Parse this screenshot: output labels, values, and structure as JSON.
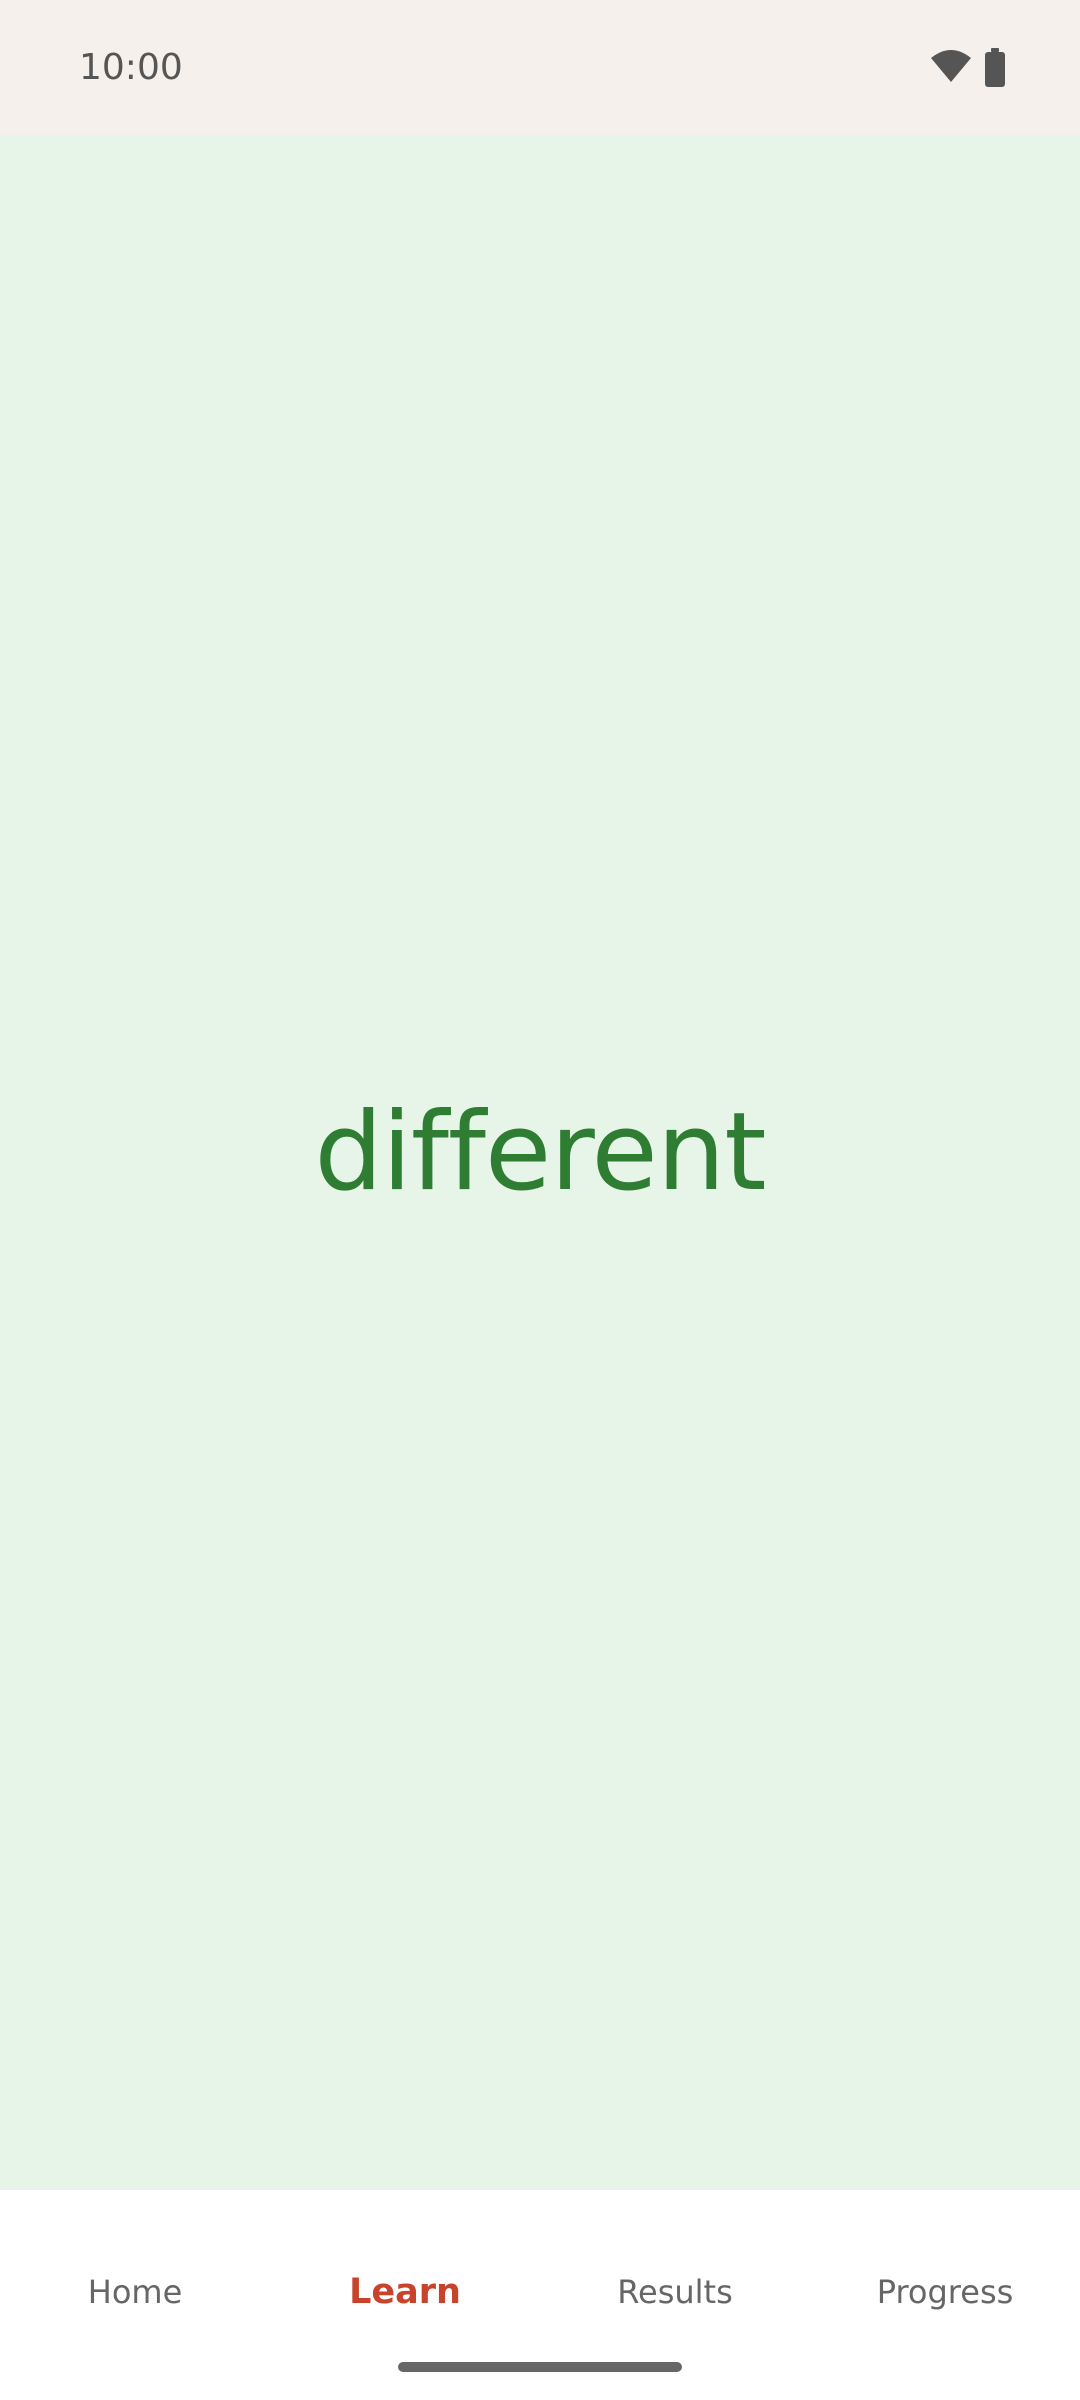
{
  "status_bar": {
    "time": "10:00",
    "icons": [
      "wifi-icon",
      "battery-icon"
    ]
  },
  "flashcard": {
    "word": "different",
    "text_color": "#2e7d32",
    "background_color": "#e7f4e8"
  },
  "bottom_nav": {
    "items": [
      {
        "label": "Home",
        "active": false
      },
      {
        "label": "Learn",
        "active": true
      },
      {
        "label": "Results",
        "active": false
      },
      {
        "label": "Progress",
        "active": false
      }
    ],
    "active_color": "#c8432b"
  }
}
